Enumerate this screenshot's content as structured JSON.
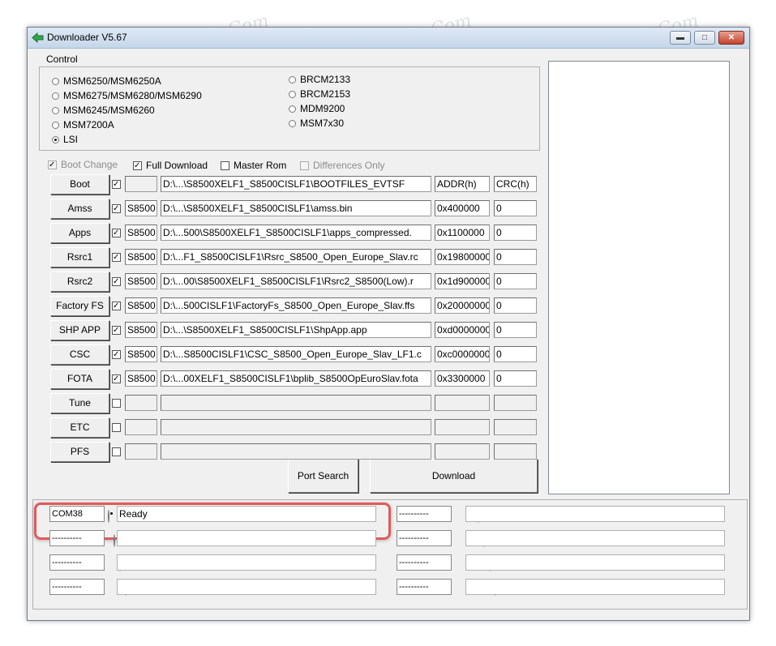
{
  "window": {
    "title": "Downloader V5.67",
    "minimize": "▬",
    "maximize": "□",
    "close": "✕"
  },
  "control_group": {
    "legend": "Control",
    "chips_left": [
      {
        "label": "MSM6250/MSM6250A",
        "selected": false
      },
      {
        "label": "MSM6275/MSM6280/MSM6290",
        "selected": false
      },
      {
        "label": "MSM6245/MSM6260",
        "selected": false
      },
      {
        "label": "MSM7200A",
        "selected": false
      },
      {
        "label": "LSI",
        "selected": true
      }
    ],
    "chips_right": [
      {
        "label": "BRCM2133",
        "selected": false
      },
      {
        "label": "BRCM2153",
        "selected": false
      },
      {
        "label": "MDM9200",
        "selected": false
      },
      {
        "label": "MSM7x30",
        "selected": false
      }
    ]
  },
  "options": {
    "boot_change": "Boot Change",
    "full_download": "Full Download",
    "master_rom": "Master Rom",
    "differences_only": "Differences Only"
  },
  "file_rows": [
    {
      "button": "Boot",
      "checked": true,
      "prefix": "",
      "path": "D:\\...\\S8500XELF1_S8500CISLF1\\BOOTFILES_EVTSF",
      "addr": "ADDR(h)",
      "crc": "CRC(h)"
    },
    {
      "button": "Amss",
      "checked": true,
      "prefix": "S8500",
      "path": "D:\\...\\S8500XELF1_S8500CISLF1\\amss.bin",
      "addr": "0x400000",
      "crc": "0"
    },
    {
      "button": "Apps",
      "checked": true,
      "prefix": "S8500",
      "path": "D:\\...500\\S8500XELF1_S8500CISLF1\\apps_compressed.",
      "addr": "0x1100000",
      "crc": "0"
    },
    {
      "button": "Rsrc1",
      "checked": true,
      "prefix": "S8500",
      "path": "D:\\...F1_S8500CISLF1\\Rsrc_S8500_Open_Europe_Slav.rc",
      "addr": "0x19800000",
      "crc": "0"
    },
    {
      "button": "Rsrc2",
      "checked": true,
      "prefix": "S8500",
      "path": "D:\\...00\\S8500XELF1_S8500CISLF1\\Rsrc2_S8500(Low).r",
      "addr": "0x1d900000",
      "crc": "0"
    },
    {
      "button": "Factory FS",
      "checked": true,
      "prefix": "S8500",
      "path": "D:\\...500CISLF1\\FactoryFs_S8500_Open_Europe_Slav.ffs",
      "addr": "0x20000000",
      "crc": "0"
    },
    {
      "button": "SHP APP",
      "checked": true,
      "prefix": "S8500",
      "path": "D:\\...\\S8500XELF1_S8500CISLF1\\ShpApp.app",
      "addr": "0xd0000000",
      "crc": "0"
    },
    {
      "button": "CSC",
      "checked": true,
      "prefix": "S8500",
      "path": "D:\\...S8500CISLF1\\CSC_S8500_Open_Europe_Slav_LF1.c",
      "addr": "0xc0000000",
      "crc": "0"
    },
    {
      "button": "FOTA",
      "checked": true,
      "prefix": "S8500",
      "path": "D:\\...00XELF1_S8500CISLF1\\bplib_S8500OpEuroSlav.fota",
      "addr": "0x3300000",
      "crc": "0"
    },
    {
      "button": "Tune",
      "checked": false,
      "prefix": "",
      "path": "",
      "addr": "",
      "crc": ""
    },
    {
      "button": "ETC",
      "checked": false,
      "prefix": "",
      "path": "",
      "addr": "",
      "crc": ""
    },
    {
      "button": "PFS",
      "checked": false,
      "prefix": "",
      "path": "",
      "addr": "",
      "crc": ""
    }
  ],
  "actions": {
    "port_search": "Port Search",
    "download": "Download"
  },
  "ports": {
    "left": [
      {
        "port": "COM38",
        "status": "Ready",
        "selected": true
      },
      {
        "port": "----------",
        "status": "",
        "selected": false
      },
      {
        "port": "----------",
        "status": "",
        "selected": false
      },
      {
        "port": "----------",
        "status": "",
        "selected": false
      }
    ],
    "right": [
      {
        "port": "----------",
        "status": "",
        "selected": false
      },
      {
        "port": "----------",
        "status": "",
        "selected": false
      },
      {
        "port": "----------",
        "status": "",
        "selected": false
      },
      {
        "port": "----------",
        "status": "",
        "selected": false
      }
    ]
  },
  "watermark": "Soringpcrepair.Com",
  "accent": {
    "highlight": "#e05a5a",
    "titlebar": "#c5d6ea"
  }
}
